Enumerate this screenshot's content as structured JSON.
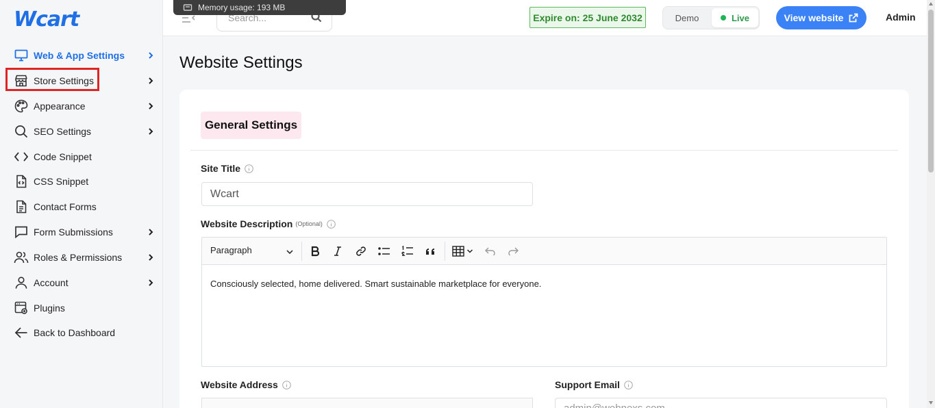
{
  "app": {
    "brand": "Wcart",
    "memory_tooltip": "Memory usage: 193 MB"
  },
  "sidebar": {
    "items": [
      {
        "label": "Web & App Settings",
        "icon": "monitor-icon",
        "has_submenu": true,
        "active": true
      },
      {
        "label": "Store Settings",
        "icon": "store-icon",
        "has_submenu": true,
        "highlighted": true
      },
      {
        "label": "Appearance",
        "icon": "palette-icon",
        "has_submenu": true
      },
      {
        "label": "SEO Settings",
        "icon": "search-icon",
        "has_submenu": true
      },
      {
        "label": "Code Snippet",
        "icon": "code-icon",
        "has_submenu": false
      },
      {
        "label": "CSS Snippet",
        "icon": "css-file-icon",
        "has_submenu": false
      },
      {
        "label": "Contact Forms",
        "icon": "document-icon",
        "has_submenu": false
      },
      {
        "label": "Form Submissions",
        "icon": "chat-icon",
        "has_submenu": true
      },
      {
        "label": "Roles & Permissions",
        "icon": "users-icon",
        "has_submenu": true
      },
      {
        "label": "Account",
        "icon": "user-icon",
        "has_submenu": true
      },
      {
        "label": "Plugins",
        "icon": "plugin-icon",
        "has_submenu": false
      },
      {
        "label": "Back to Dashboard",
        "icon": "arrow-left-icon",
        "has_submenu": false
      }
    ]
  },
  "topbar": {
    "search_placeholder": "Search...",
    "expire_label": "Expire on: 25 June 2032",
    "env_demo": "Demo",
    "env_live": "Live",
    "view_website": "View website",
    "user": "Admin"
  },
  "main": {
    "page_title": "Website Settings",
    "section_title": "General Settings",
    "site_title_label": "Site Title",
    "site_title_value": "Wcart",
    "description_label": "Website Description",
    "description_optional": "(Optional)",
    "editor_block_format": "Paragraph",
    "description_value": "Consciously selected, home delivered. Smart sustainable marketplace for everyone.",
    "address_label": "Website Address",
    "support_email_label": "Support Email",
    "support_email_value": "admin@webnexs.com"
  },
  "colors": {
    "accent": "#1f6fe5",
    "button": "#3b82f6",
    "live": "#22b357",
    "expire_border": "#5cb85c",
    "highlight": "#e02424",
    "section_bg": "#fde8ef"
  }
}
